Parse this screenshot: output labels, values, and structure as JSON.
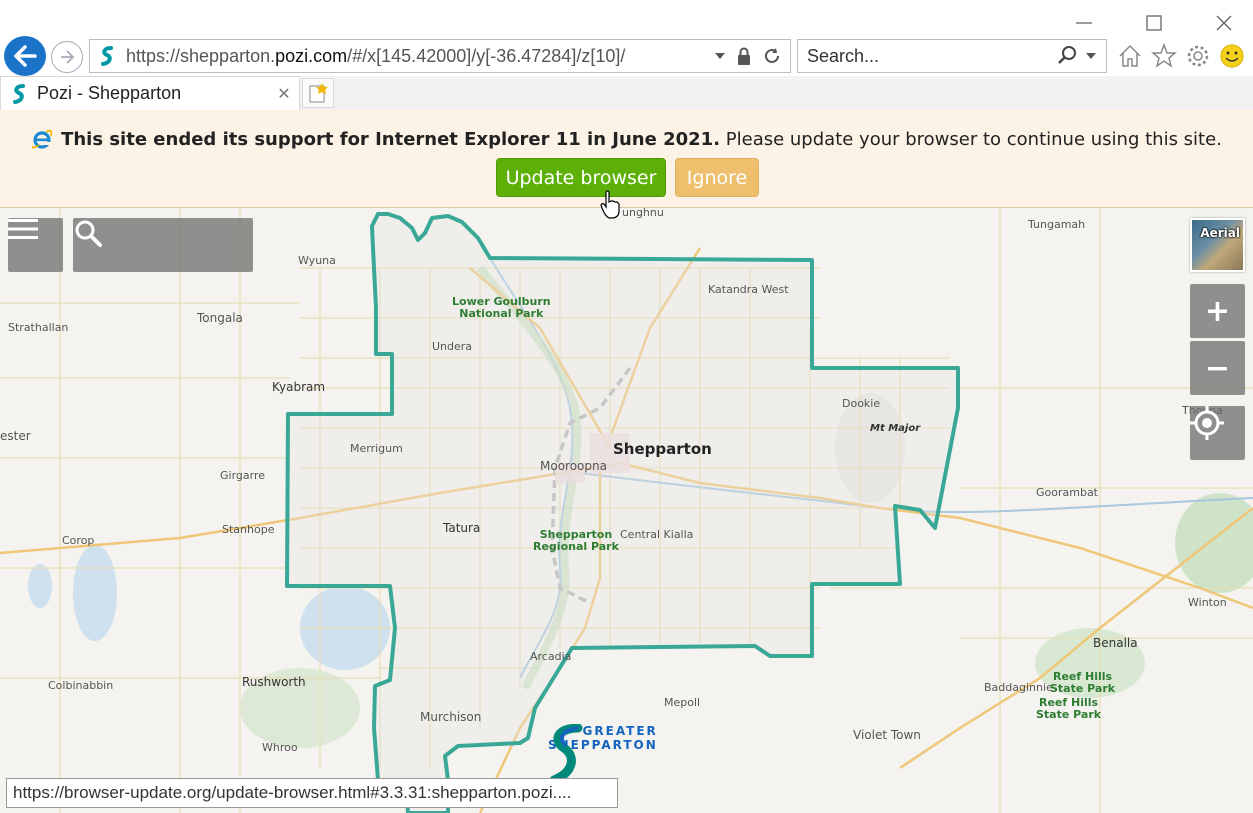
{
  "browser": {
    "url_prefix": "https://shepparton.",
    "url_domain": "pozi.com",
    "url_suffix": "/#/x[145.42000]/y[-36.47284]/z[10]/",
    "search_placeholder": "Search...",
    "tab_title": "Pozi - Shepparton"
  },
  "banner": {
    "bold_text": "This site ended its support for Internet Explorer 11 in June 2021.",
    "text": "Please update your browser to continue using this site.",
    "update_label": "Update browser",
    "ignore_label": "Ignore"
  },
  "map": {
    "aerial_label": "Aerial",
    "zoom_in_label": "+",
    "zoom_out_label": "−",
    "labels": {
      "tungamah": "Tungamah",
      "wyuna": "Wyuna",
      "katandra_west": "Katandra West",
      "lower_goulburn_1": "Lower Goulburn",
      "lower_goulburn_2": "National Park",
      "strathallan": "Strathallan",
      "tongala": "Tongala",
      "undera": "Undera",
      "kyabram": "Kyabram",
      "dookie": "Dookie",
      "mt_major": "Mt Major",
      "thoona": "Thoona",
      "ester": "ester",
      "merrigum": "Merrigum",
      "shepparton": "Shepparton",
      "mooroopna": "Mooroopna",
      "girgarre": "Girgarre",
      "goorambat": "Goorambat",
      "stanhope": "Stanhope",
      "tatura": "Tatura",
      "corop": "Corop",
      "sp_1": "Shepparton",
      "sp_2": "Regional Park",
      "central_kialla": "Central Kialla",
      "winton": "Winton",
      "benalla": "Benalla",
      "arcadia": "Arcadia",
      "colbinabbin": "Colbinabbin",
      "rushworth": "Rushworth",
      "baddaginnie": "Baddaginnie",
      "reef_hills_1a": "Reef Hills",
      "reef_hills_1b": "State Park",
      "reef_hills_2a": "Reef Hills",
      "reef_hills_2b": "State Park",
      "murchison": "Murchison",
      "mepoll": "Mepoll",
      "whroo": "Whroo",
      "violet_town": "Violet Town",
      "tunghnu": "unghnu"
    },
    "logo_line1": "GREATER",
    "logo_line2": "SHEPPARTON"
  },
  "status_bar": {
    "text": "https://browser-update.org/update-browser.html#3.3.31:shepparton.pozi...."
  },
  "colors": {
    "boundary": "#3aa896",
    "update_green": "#5cb008",
    "ignore_orange": "#eec06d",
    "ie_blue": "#1a73c9"
  }
}
